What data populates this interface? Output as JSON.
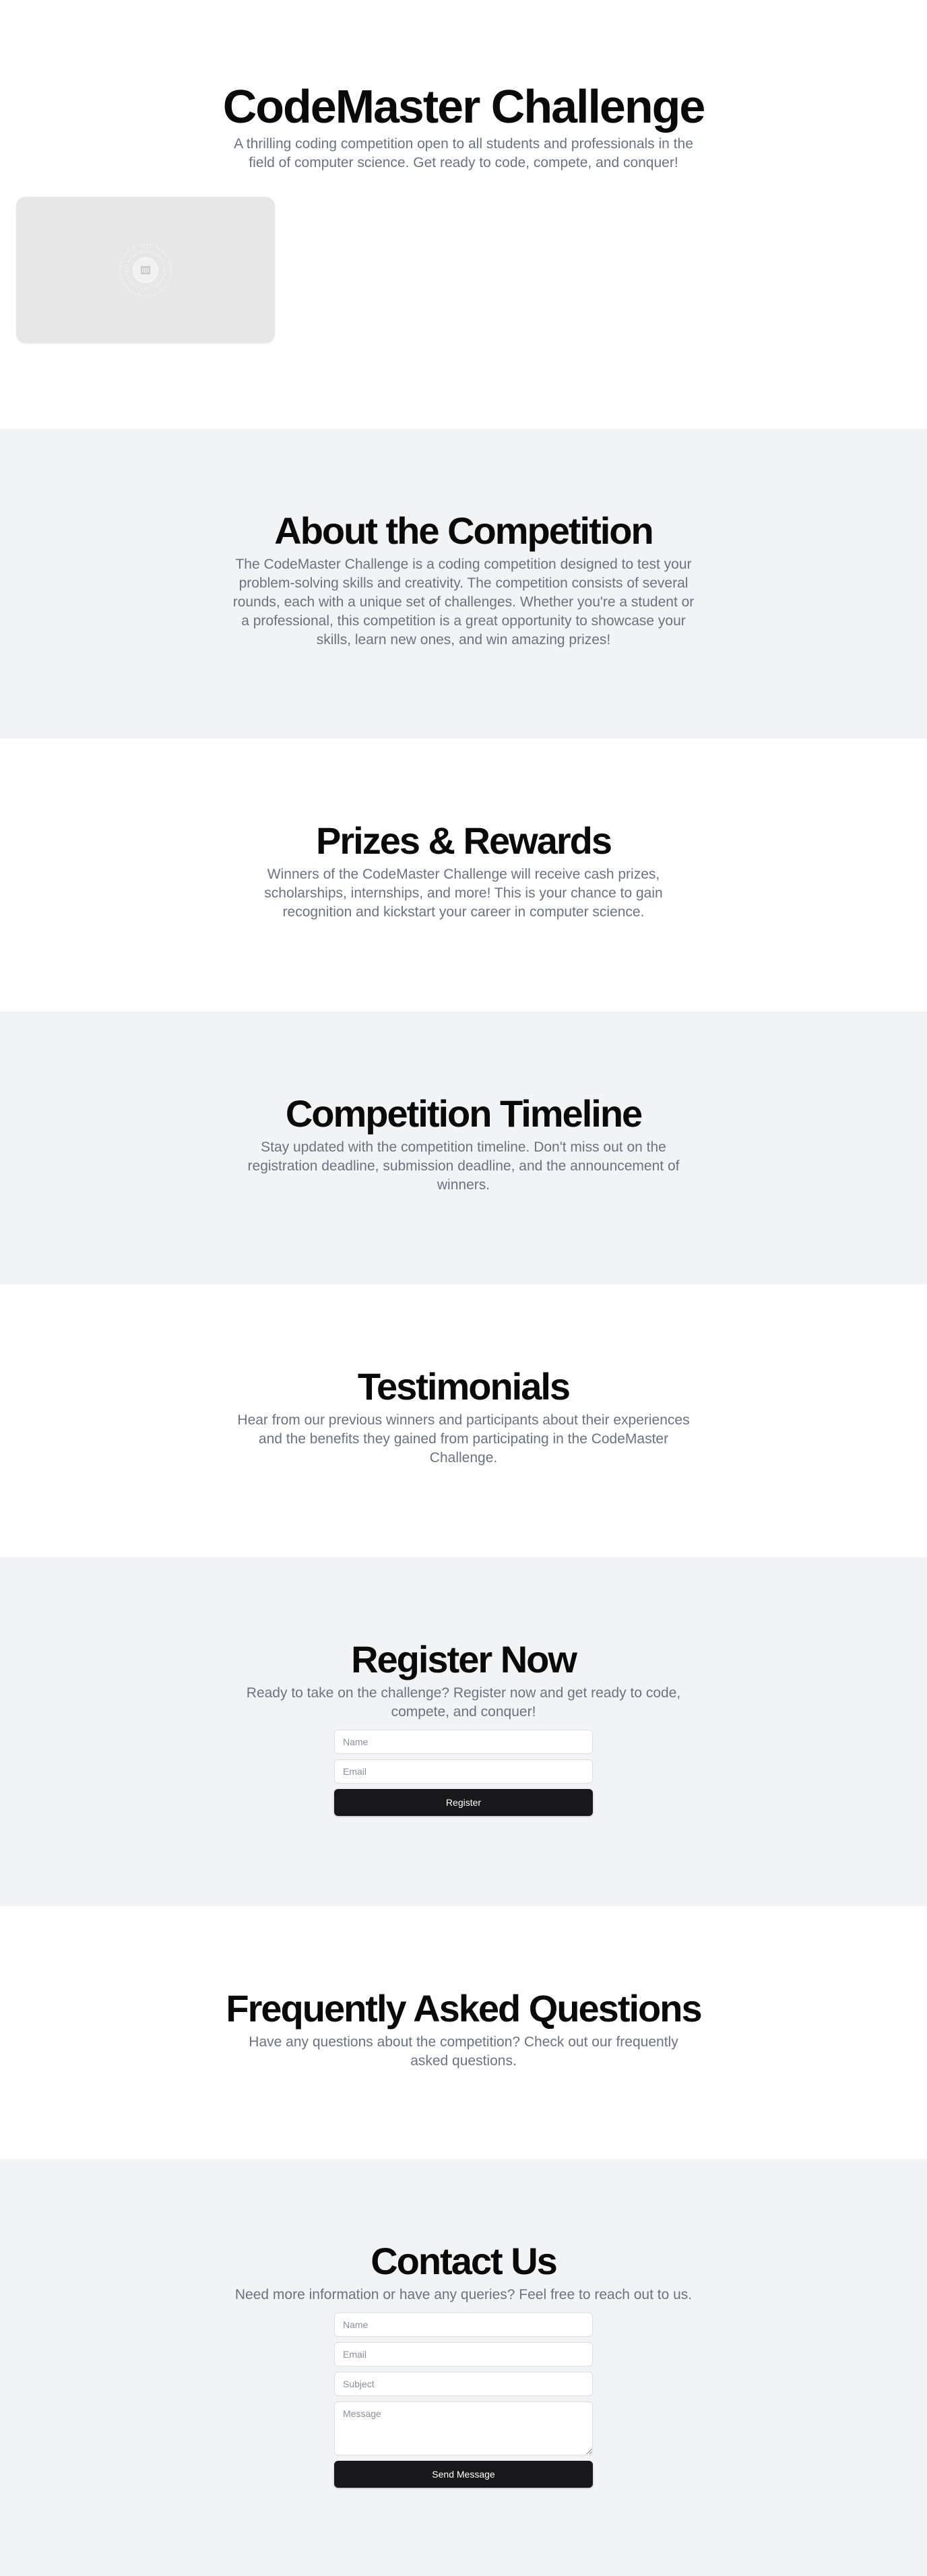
{
  "hero": {
    "title": "CodeMaster Challenge",
    "subtitle": "A thrilling coding competition open to all students and professionals in the field of computer science. Get ready to code, compete, and conquer!",
    "image": {
      "icon": "image-placeholder-icon"
    }
  },
  "about": {
    "title": "About the Competition",
    "text": "The CodeMaster Challenge is a coding competition designed to test your problem-solving skills and creativity. The competition consists of several rounds, each with a unique set of challenges. Whether you're a student or a professional, this competition is a great opportunity to showcase your skills, learn new ones, and win amazing prizes!"
  },
  "prizes": {
    "title": "Prizes & Rewards",
    "text": "Winners of the CodeMaster Challenge will receive cash prizes, scholarships, internships, and more! This is your chance to gain recognition and kickstart your career in computer science."
  },
  "timeline": {
    "title": "Competition Timeline",
    "text": "Stay updated with the competition timeline. Don't miss out on the registration deadline, submission deadline, and the announcement of winners."
  },
  "testimonials": {
    "title": "Testimonials",
    "text": "Hear from our previous winners and participants about their experiences and the benefits they gained from participating in the CodeMaster Challenge."
  },
  "register": {
    "title": "Register Now",
    "text": "Ready to take on the challenge? Register now and get ready to code, compete, and conquer!",
    "name_placeholder": "Name",
    "email_placeholder": "Email",
    "button_label": "Register"
  },
  "faq": {
    "title": "Frequently Asked Questions",
    "text": "Have any questions about the competition? Check out our frequently asked questions."
  },
  "contact": {
    "title": "Contact Us",
    "text": "Need more information or have any queries? Feel free to reach out to us.",
    "name_placeholder": "Name",
    "email_placeholder": "Email",
    "subject_placeholder": "Subject",
    "message_placeholder": "Message",
    "button_label": "Send Message"
  },
  "colors": {
    "text_muted": "#6b7280",
    "section_gray": "#f2f3f5",
    "button_bg": "#18181b"
  }
}
